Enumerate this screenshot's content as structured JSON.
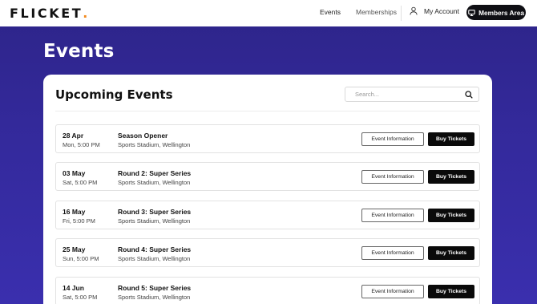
{
  "brand": {
    "name": "FLICKET",
    "dot": ".",
    "dot_color": "#f28a1e"
  },
  "nav": {
    "events": "Events",
    "memberships": "Memberships",
    "my_account": "My Account",
    "members_area": "Members Area"
  },
  "page_title": "Events",
  "upcoming": {
    "title": "Upcoming Events",
    "search_placeholder": "Search..."
  },
  "events": [
    {
      "date": "28 Apr",
      "time": "Mon, 5:00 PM",
      "name": "Season Opener",
      "venue": "Sports Stadium, Wellington",
      "info_label": "Event Information",
      "buy_label": "Buy Tickets"
    },
    {
      "date": "03 May",
      "time": "Sat, 5:00 PM",
      "name": "Round 2: Super Series",
      "venue": "Sports Stadium, Wellington",
      "info_label": "Event Information",
      "buy_label": "Buy Tickets"
    },
    {
      "date": "16 May",
      "time": "Fri, 5:00 PM",
      "name": "Round 3: Super Series",
      "venue": "Sports Stadium, Wellington",
      "info_label": "Event Information",
      "buy_label": "Buy Tickets"
    },
    {
      "date": "25 May",
      "time": "Sun, 5:00 PM",
      "name": "Round 4: Super Series",
      "venue": "Sports Stadium, Wellington",
      "info_label": "Event Information",
      "buy_label": "Buy Tickets"
    },
    {
      "date": "14 Jun",
      "time": "Sat, 5:00 PM",
      "name": "Round 5: Super Series",
      "venue": "Sports Stadium, Wellington",
      "info_label": "Event Information",
      "buy_label": "Buy Tickets"
    }
  ],
  "colors": {
    "background": "#2d2488",
    "accent": "#f28a1e",
    "button_dark": "#0a0a0a"
  },
  "icons": {
    "account": "user-icon",
    "members": "monitor-icon",
    "search": "search-icon"
  }
}
